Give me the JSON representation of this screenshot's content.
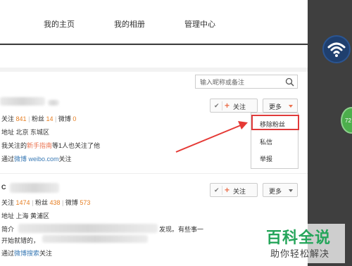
{
  "nav": {
    "home": "我的主页",
    "album": "我的相册",
    "manage": "管理中心"
  },
  "search": {
    "placeholder": "输入昵称或备注"
  },
  "user1": {
    "stats": {
      "follow_label": "关注",
      "follow_count": "841",
      "fans_label": "粉丝",
      "fans_count": "14",
      "weibo_label": "微博",
      "weibo_count": "0"
    },
    "location": "地址 北京 东城区",
    "mutual_prefix": "我关注的",
    "mutual_link": "新手指南",
    "mutual_suffix": "等1人也关注了他",
    "source_prefix": "通过",
    "source_link": "微博 weibo.com",
    "source_suffix": "关注",
    "follow_button": "关注",
    "more_button": "更多",
    "menu": [
      "移除粉丝",
      "私信",
      "举报"
    ]
  },
  "user2": {
    "stats": {
      "follow_label": "关注",
      "follow_count": "1474",
      "fans_label": "粉丝",
      "fans_count": "438",
      "weibo_label": "微博",
      "weibo_count": "573"
    },
    "location": "地址 上海 黄浦区",
    "intro_visible": "简介",
    "intro_tail": "发现。有些事一",
    "intro_line2": "开始就错的，",
    "source_prefix": "通过",
    "source_link": "微博搜索",
    "source_suffix": "关注",
    "follow_button": "关注",
    "more_button": "更多"
  },
  "watermark": {
    "title": "百科全说",
    "subtitle": "助你轻松解决"
  },
  "badge": "72",
  "colors": {
    "accent": "#eb7350",
    "highlight": "#e03a3a",
    "watermark_green": "#25a55a"
  }
}
